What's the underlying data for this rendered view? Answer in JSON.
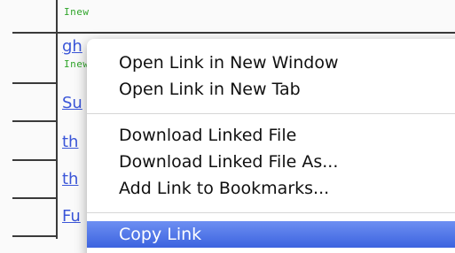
{
  "page": {
    "new_badge": "Inew",
    "links": [
      "gh",
      "Su",
      "th",
      "th",
      "Fu"
    ]
  },
  "context_menu": {
    "items": [
      "Open Link in New Window",
      "Open Link in New Tab",
      "Download Linked File",
      "Download Linked File As...",
      "Add Link to Bookmarks...",
      "Copy Link"
    ],
    "highlighted_item": "Copy Link"
  }
}
